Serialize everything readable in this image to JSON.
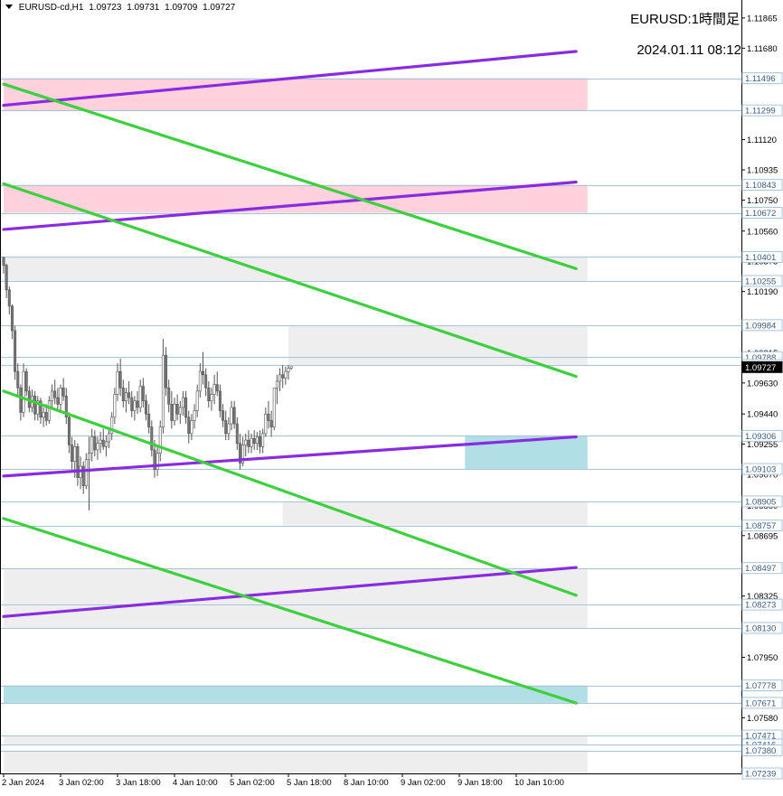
{
  "header": {
    "symbol": "EURUSD-cd,H1",
    "ohlc": [
      "1.09723",
      "1.09731",
      "1.09709",
      "1.09727"
    ]
  },
  "overlay": {
    "title": "EURUSD:1時間足",
    "datetime": "2024.01.11 08:12"
  },
  "chart_data": {
    "type": "candlestick",
    "ylim": [
      1.07239,
      1.11975
    ],
    "y_ticks": [
      "1.11865",
      "1.11680",
      "1.11120",
      "1.10935",
      "1.10750",
      "1.10560",
      "1.10375",
      "1.10190",
      "1.09815",
      "1.09630",
      "1.09440",
      "1.09255",
      "1.09070",
      "1.08880",
      "1.08695",
      "1.08325",
      "1.07950",
      "1.07580",
      "1.07395"
    ],
    "x_ticks": [
      "2 Jan 2024",
      "3 Jan 02:00",
      "3 Jan 18:00",
      "4 Jan 10:00",
      "5 Jan 02:00",
      "5 Jan 18:00",
      "8 Jan 10:00",
      "9 Jan 02:00",
      "9 Jan 18:00",
      "10 Jan 10:00"
    ],
    "level_labels": [
      "1.11496",
      "1.11299",
      "1.10843",
      "1.10672",
      "1.10401",
      "1.10255",
      "1.09984",
      "1.09788",
      "1.09740",
      "1.09727",
      "1.09306",
      "1.09103",
      "1.08905",
      "1.08757",
      "1.08497",
      "1.08273",
      "1.08130",
      "1.07778",
      "1.07671",
      "1.07471",
      "1.07416",
      "1.07380",
      "1.07239"
    ],
    "current_price": "1.09727",
    "zones": [
      {
        "kind": "supply",
        "color": "#ffd1dc",
        "top": 1.11496,
        "bottom": 1.11299,
        "x_start": 0,
        "x_end": 205
      },
      {
        "kind": "supply",
        "color": "#ffd1dc",
        "top": 1.10843,
        "bottom": 1.10672,
        "x_start": 0,
        "x_end": 205
      },
      {
        "kind": "range",
        "color": "#eeeeee",
        "top": 1.10401,
        "bottom": 1.10255,
        "x_start": 0,
        "x_end": 205
      },
      {
        "kind": "range",
        "color": "#eeeeee",
        "top": 1.09984,
        "bottom": 1.0974,
        "x_start": 100,
        "x_end": 205
      },
      {
        "kind": "demand",
        "color": "#b1dfe5",
        "top": 1.09306,
        "bottom": 1.09103,
        "x_start": 162,
        "x_end": 205
      },
      {
        "kind": "range",
        "color": "#eeeeee",
        "top": 1.08905,
        "bottom": 1.08757,
        "x_start": 98,
        "x_end": 205
      },
      {
        "kind": "range",
        "color": "#eeeeee",
        "top": 1.08497,
        "bottom": 1.0813,
        "x_start": 0,
        "x_end": 205
      },
      {
        "kind": "demand",
        "color": "#b1dfe5",
        "top": 1.07778,
        "bottom": 1.07671,
        "x_start": 0,
        "x_end": 205
      },
      {
        "kind": "range",
        "color": "#eeeeee",
        "top": 1.07471,
        "bottom": 1.07416,
        "x_start": 0,
        "x_end": 205
      },
      {
        "kind": "range",
        "color": "#eeeeee",
        "top": 1.0738,
        "bottom": 1.07239,
        "x_start": 0,
        "x_end": 205
      }
    ],
    "trendlines": [
      {
        "color": "#8a2be2",
        "from": [
          0,
          1.1133
        ],
        "to": [
          201,
          1.1166
        ]
      },
      {
        "color": "#8a2be2",
        "from": [
          0,
          1.1057
        ],
        "to": [
          201,
          1.1086
        ]
      },
      {
        "color": "#8a2be2",
        "from": [
          0,
          1.0906
        ],
        "to": [
          201,
          1.093
        ]
      },
      {
        "color": "#8a2be2",
        "from": [
          0,
          1.082
        ],
        "to": [
          201,
          1.085
        ]
      },
      {
        "color": "#3ecf3e",
        "from": [
          0,
          1.1146
        ],
        "to": [
          201,
          1.1033
        ]
      },
      {
        "color": "#3ecf3e",
        "from": [
          0,
          1.1085
        ],
        "to": [
          201,
          1.0967
        ]
      },
      {
        "color": "#3ecf3e",
        "from": [
          0,
          1.0958
        ],
        "to": [
          201,
          1.0833
        ]
      },
      {
        "color": "#3ecf3e",
        "from": [
          0,
          1.088
        ],
        "to": [
          201,
          1.0767
        ]
      }
    ],
    "candles": [
      [
        1.104,
        1.104,
        1.103,
        1.1035
      ],
      [
        1.1035,
        1.1036,
        1.1015,
        1.102
      ],
      [
        1.102,
        1.1022,
        1.1005,
        1.101
      ],
      [
        1.101,
        1.1011,
        1.099,
        1.0995
      ],
      [
        1.0995,
        1.0998,
        1.0965,
        1.097
      ],
      [
        1.097,
        1.0975,
        1.0955,
        1.096
      ],
      [
        1.096,
        1.0962,
        1.094,
        1.0945
      ],
      [
        1.0945,
        1.0975,
        1.0942,
        1.097
      ],
      [
        1.097,
        1.0972,
        1.0955,
        1.0958
      ],
      [
        1.0958,
        1.0961,
        1.0945,
        1.0948
      ],
      [
        1.0948,
        1.0959,
        1.0945,
        1.0955
      ],
      [
        1.0955,
        1.0958,
        1.094,
        1.0944
      ],
      [
        1.0944,
        1.0955,
        1.094,
        1.0952
      ],
      [
        1.0952,
        1.0954,
        1.0938,
        1.0942
      ],
      [
        1.0942,
        1.0948,
        1.0936,
        1.0945
      ],
      [
        1.0945,
        1.095,
        1.0937,
        1.094
      ],
      [
        1.094,
        1.0955,
        1.0938,
        1.0952
      ],
      [
        1.0952,
        1.0962,
        1.0948,
        1.0958
      ],
      [
        1.0958,
        1.0965,
        1.095,
        1.0954
      ],
      [
        1.0954,
        1.096,
        1.0947,
        1.095
      ],
      [
        1.095,
        1.0962,
        1.0946,
        1.096
      ],
      [
        1.096,
        1.0966,
        1.0952,
        1.0955
      ],
      [
        1.0955,
        1.096,
        1.0938,
        1.0942
      ],
      [
        1.0942,
        1.0945,
        1.092,
        1.0925
      ],
      [
        1.0925,
        1.093,
        1.091,
        1.0915
      ],
      [
        1.0915,
        1.0928,
        1.0905,
        1.0924
      ],
      [
        1.0924,
        1.0926,
        1.09,
        1.0905
      ],
      [
        1.0905,
        1.0918,
        1.0898,
        1.0912
      ],
      [
        1.0912,
        1.0915,
        1.0895,
        1.09
      ],
      [
        1.09,
        1.092,
        1.0898,
        1.0916
      ],
      [
        1.0916,
        1.093,
        1.0885,
        1.092
      ],
      [
        1.092,
        1.0935,
        1.0915,
        1.093
      ],
      [
        1.093,
        1.0934,
        1.0918,
        1.0922
      ],
      [
        1.0922,
        1.093,
        1.0916,
        1.0926
      ],
      [
        1.0926,
        1.0933,
        1.092,
        1.0928
      ],
      [
        1.0928,
        1.0935,
        1.0922,
        1.0924
      ],
      [
        1.0924,
        1.0931,
        1.0918,
        1.0927
      ],
      [
        1.0927,
        1.0935,
        1.0923,
        1.0932
      ],
      [
        1.0932,
        1.0945,
        1.0928,
        1.0942
      ],
      [
        1.0942,
        1.096,
        1.0938,
        1.0956
      ],
      [
        1.0956,
        1.0975,
        1.0952,
        1.097
      ],
      [
        1.097,
        1.0978,
        1.0955,
        1.096
      ],
      [
        1.096,
        1.0965,
        1.0948,
        1.0952
      ],
      [
        1.0952,
        1.096,
        1.0945,
        1.0957
      ],
      [
        1.0957,
        1.0964,
        1.095,
        1.0954
      ],
      [
        1.0954,
        1.0958,
        1.0942,
        1.0946
      ],
      [
        1.0946,
        1.0955,
        1.094,
        1.0952
      ],
      [
        1.0952,
        1.0958,
        1.0944,
        1.0948
      ],
      [
        1.0948,
        1.0965,
        1.0945,
        1.0961
      ],
      [
        1.0961,
        1.0966,
        1.0948,
        1.0952
      ],
      [
        1.0952,
        1.0956,
        1.094,
        1.0944
      ],
      [
        1.0944,
        1.095,
        1.0932,
        1.0936
      ],
      [
        1.0936,
        1.094,
        1.0918,
        1.0922
      ],
      [
        1.0922,
        1.0928,
        1.0905,
        1.091
      ],
      [
        1.091,
        1.0925,
        1.0906,
        1.092
      ],
      [
        1.092,
        1.094,
        1.0915,
        1.0936
      ],
      [
        1.0936,
        1.099,
        1.0932,
        1.098
      ],
      [
        1.098,
        1.0985,
        1.0955,
        1.096
      ],
      [
        1.096,
        1.0965,
        1.0945,
        1.095
      ],
      [
        1.095,
        1.0958,
        1.0935,
        1.094
      ],
      [
        1.094,
        1.0954,
        1.0937,
        1.095
      ],
      [
        1.095,
        1.0956,
        1.094,
        1.0944
      ],
      [
        1.0944,
        1.0952,
        1.0938,
        1.0948
      ],
      [
        1.0948,
        1.0958,
        1.0943,
        1.0954
      ],
      [
        1.0954,
        1.0958,
        1.0938,
        1.0942
      ],
      [
        1.0942,
        1.0946,
        1.0926,
        1.0932
      ],
      [
        1.0932,
        1.0944,
        1.0928,
        1.094
      ],
      [
        1.094,
        1.095,
        1.0935,
        1.0946
      ],
      [
        1.0946,
        1.0962,
        1.0942,
        1.0958
      ],
      [
        1.0958,
        1.0975,
        1.0954,
        1.097
      ],
      [
        1.097,
        1.0982,
        1.0962,
        1.0968
      ],
      [
        1.0968,
        1.0972,
        1.0955,
        1.096
      ],
      [
        1.096,
        1.0964,
        1.0948,
        1.0952
      ],
      [
        1.0952,
        1.096,
        1.0946,
        1.0956
      ],
      [
        1.0956,
        1.0968,
        1.095,
        1.0962
      ],
      [
        1.0962,
        1.097,
        1.0955,
        1.0958
      ],
      [
        1.0958,
        1.0962,
        1.0942,
        1.0946
      ],
      [
        1.0946,
        1.095,
        1.0936,
        1.094
      ],
      [
        1.094,
        1.0946,
        1.0928,
        1.0932
      ],
      [
        1.0932,
        1.0942,
        1.0928,
        1.0938
      ],
      [
        1.0938,
        1.0952,
        1.0934,
        1.0948
      ],
      [
        1.0948,
        1.0952,
        1.0935,
        1.0938
      ],
      [
        1.0938,
        1.0942,
        1.0922,
        1.0926
      ],
      [
        1.0926,
        1.0932,
        1.091,
        1.0914
      ],
      [
        1.0914,
        1.093,
        1.0912,
        1.0925
      ],
      [
        1.0925,
        1.0932,
        1.0918,
        1.0928
      ],
      [
        1.0928,
        1.0934,
        1.092,
        1.0924
      ],
      [
        1.0924,
        1.0932,
        1.092,
        1.0929
      ],
      [
        1.0929,
        1.0934,
        1.0922,
        1.0926
      ],
      [
        1.0926,
        1.0933,
        1.0922,
        1.093
      ],
      [
        1.093,
        1.0934,
        1.092,
        1.0924
      ],
      [
        1.0924,
        1.0935,
        1.092,
        1.0932
      ],
      [
        1.0932,
        1.0948,
        1.093,
        1.0944
      ],
      [
        1.0944,
        1.0952,
        1.0935,
        1.094
      ],
      [
        1.094,
        1.0946,
        1.093,
        1.0936
      ],
      [
        1.0936,
        1.0955,
        1.0934,
        1.096
      ],
      [
        1.096,
        1.0968,
        1.095,
        1.0964
      ],
      [
        1.0964,
        1.0972,
        1.0958,
        1.0968
      ],
      [
        1.0968,
        1.0974,
        1.096,
        1.0966
      ],
      [
        1.0966,
        1.0973,
        1.0962,
        1.097
      ],
      [
        1.097,
        1.0974,
        1.0965,
        1.0972
      ],
      [
        1.0972,
        1.0973,
        1.0971,
        1.0973
      ]
    ]
  }
}
